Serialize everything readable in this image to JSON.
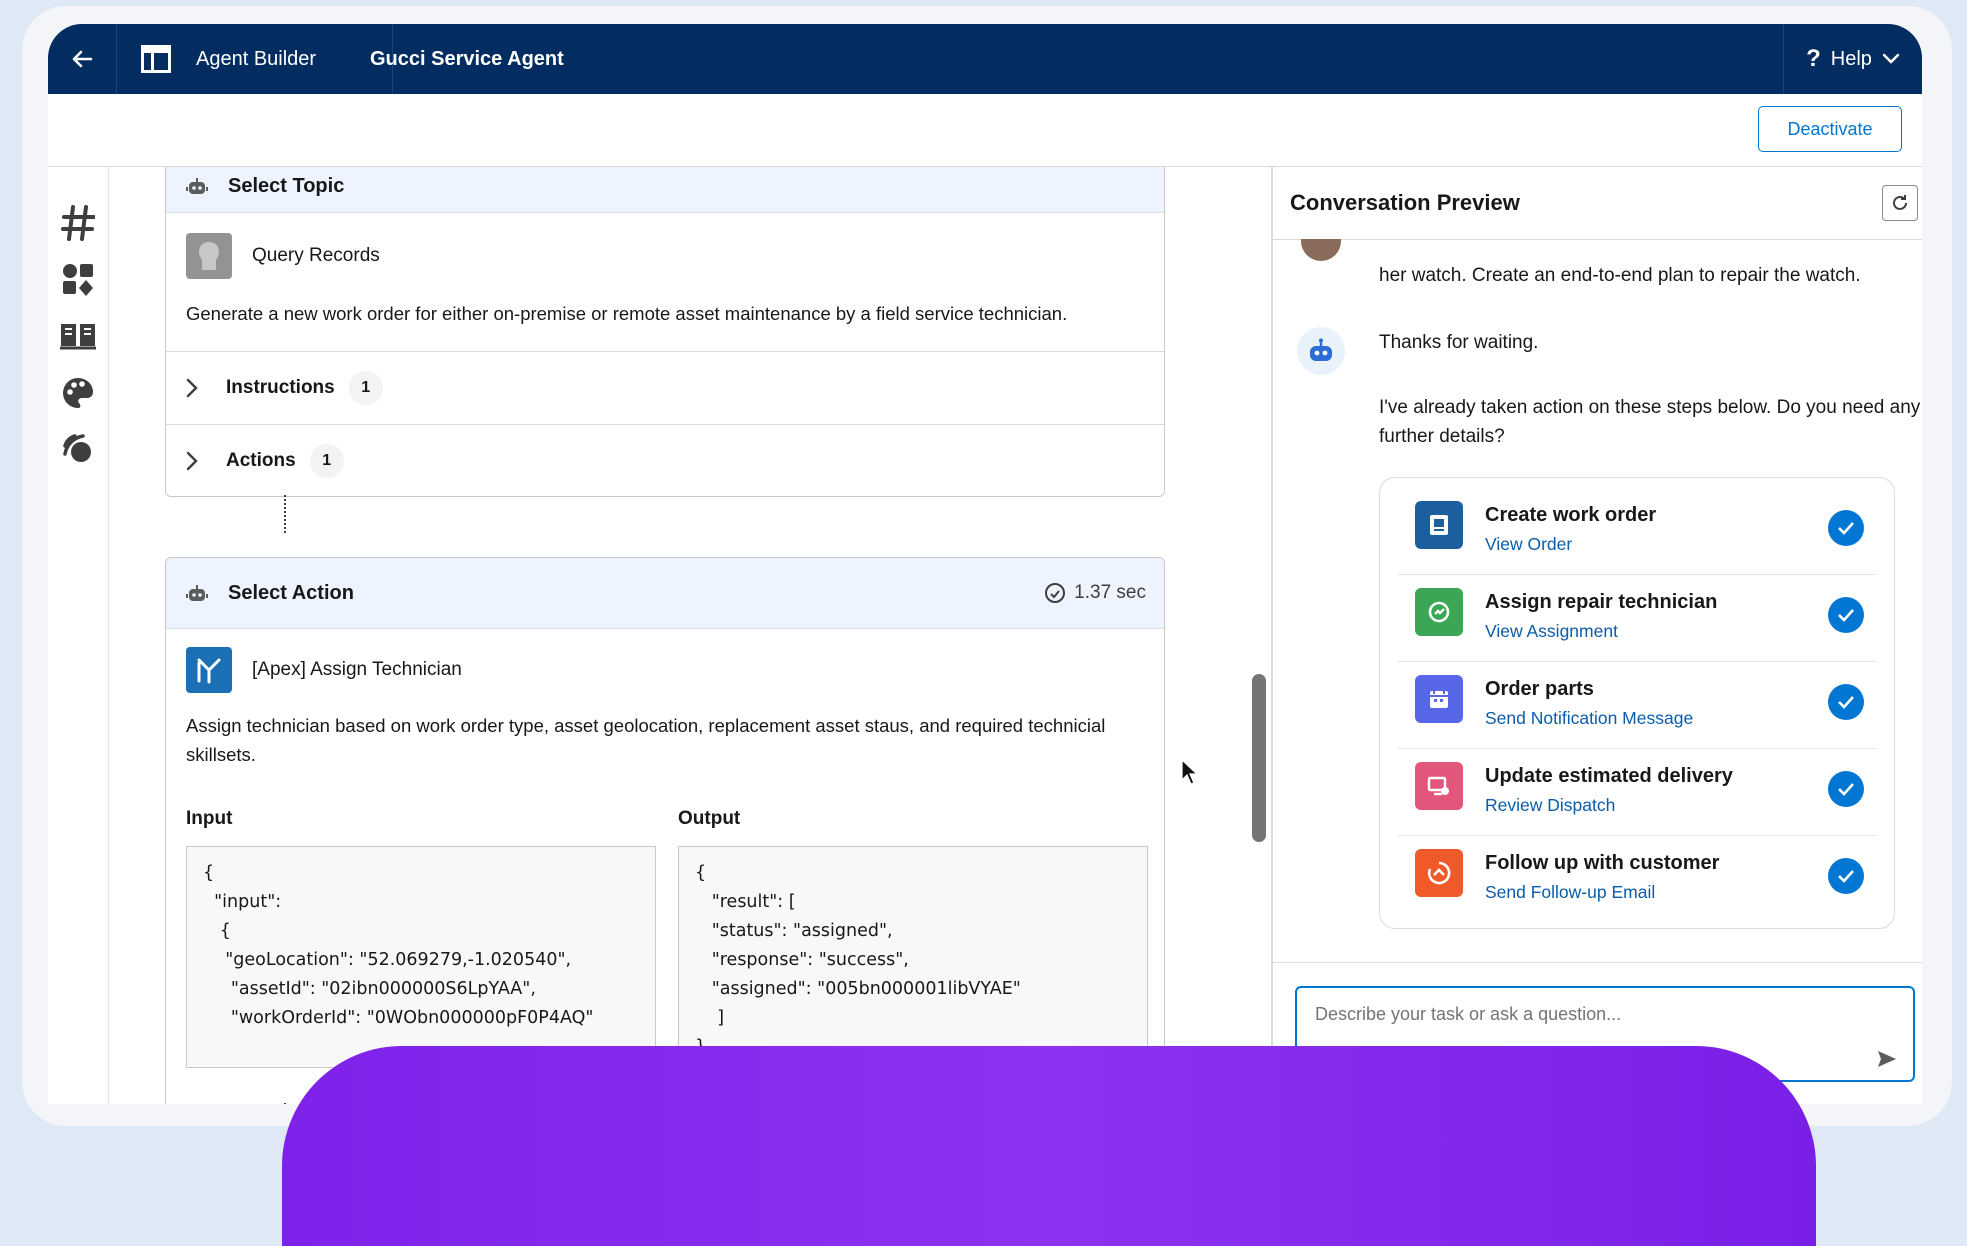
{
  "header": {
    "app_name": "Agent Builder",
    "agent_name": "Gucci Service Agent",
    "help_label": "Help"
  },
  "toolbar": {
    "deactivate_label": "Deactivate"
  },
  "topic_card": {
    "title": "Select Topic",
    "item_name": "Query Records",
    "description": "Generate a new work order for either on-premise or remote asset maintenance by a field service technician.",
    "sections": [
      {
        "label": "Instructions",
        "count": "1"
      },
      {
        "label": "Actions",
        "count": "1"
      }
    ]
  },
  "action_card": {
    "title": "Select Action",
    "duration": "1.37 sec",
    "item_name": "[Apex] Assign Technician",
    "description": "Assign technician based on work order type, asset geolocation, replacement asset staus, and required technicial skillsets.",
    "input_label": "Input",
    "output_label": "Output",
    "input_code": "{\n  \"input\":\n   {\n    \"geoLocation\": \"52.069279,-1.020540\",\n     \"assetId\": \"02ibn000000S6LpYAA\",\n     \"workOrderId\": \"0WObn000000pF0P4AQ\"",
    "output_code": "{\n   \"result\": [\n   \"status\": \"assigned\",\n   \"response\": \"success\",\n   \"assigned\": \"005bn000001libVYAE\"\n    ]\n}"
  },
  "preview": {
    "title": "Conversation Preview",
    "user_message_tail": "her watch. Create an end-to-end plan to repair the watch.",
    "bot_message_1": "Thanks for waiting.",
    "bot_message_2": "I've already taken action on these steps below. Do you need any further details?",
    "steps": [
      {
        "title": "Create work order",
        "link": "View Order",
        "icon": "work-order-icon",
        "color": "#1b5f9e"
      },
      {
        "title": "Assign repair technician",
        "link": "View Assignment",
        "icon": "technician-icon",
        "color": "#3ba755"
      },
      {
        "title": "Order parts",
        "link": "Send Notification Message",
        "icon": "parts-order-icon",
        "color": "#5867e8"
      },
      {
        "title": "Update estimated delivery",
        "link": "Review Dispatch",
        "icon": "delivery-icon",
        "color": "#e3567b"
      },
      {
        "title": "Follow up with customer",
        "link": "Send Follow-up Email",
        "icon": "follow-up-icon",
        "color": "#f05a2b"
      }
    ],
    "input_placeholder": "Describe your task or ask a question..."
  },
  "colors": {
    "header_bg": "#032d60",
    "brand_blue": "#0176d3",
    "link_blue": "#0b5cab",
    "purple_band": "#8d32f0"
  }
}
